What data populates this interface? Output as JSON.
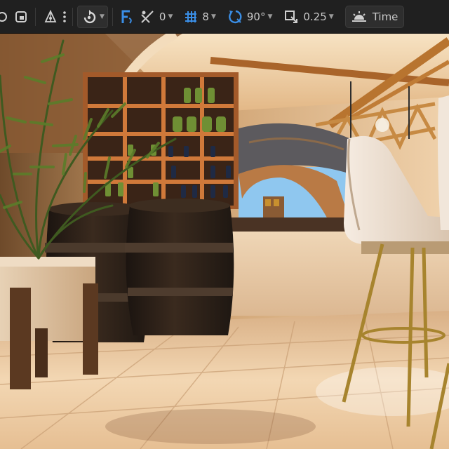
{
  "toolbar": {
    "items": [
      {
        "id": "rotate_pivot",
        "value": ""
      },
      {
        "id": "surface_snap",
        "value": ""
      },
      {
        "id": "grid_snap",
        "value": "0"
      },
      {
        "id": "grid_size",
        "value": "8"
      },
      {
        "id": "rotation_snap",
        "value": "90°"
      },
      {
        "id": "scale_snap",
        "value": "0.25"
      }
    ],
    "time_label": "Time"
  },
  "colors": {
    "toolbar_bg": "#202020",
    "accent_blue": "#3a8ee6",
    "wall": "#e9c9a2",
    "ceiling_beam": "#b8742f",
    "sky": "#8fc7ef",
    "floor": "#f2d6b2"
  },
  "icons": [
    "transform-icon",
    "snap-icon",
    "pivot-icon",
    "more-vert-icon",
    "rotate-mode-icon",
    "focus-icon",
    "angle-snap-icon",
    "grid-icon",
    "rotate-snap-icon",
    "scale-snap-icon",
    "time-of-day-icon"
  ]
}
